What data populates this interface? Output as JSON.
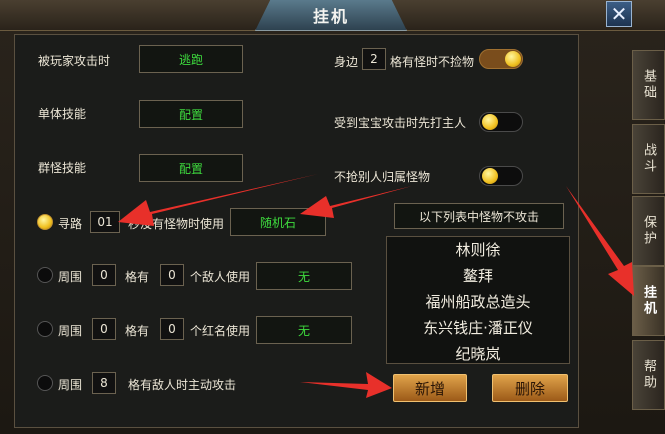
{
  "window": {
    "title": "挂机",
    "close_symbol": "✕"
  },
  "left": {
    "attacked_by_player": {
      "label": "被玩家攻击时",
      "value": "逃跑"
    },
    "single_skill": {
      "label": "单体技能",
      "value": "配置"
    },
    "group_skill": {
      "label": "群怪技能",
      "value": "配置"
    },
    "find_path": {
      "label": "寻路",
      "seconds": "01",
      "text": "秒没有怪物时使用",
      "item": "随机石"
    },
    "around_enemy": {
      "label": "周围",
      "count": "0",
      "mid": "格有",
      "num": "0",
      "text": "个敌人使用",
      "item": "无"
    },
    "around_red": {
      "label": "周围",
      "count": "0",
      "mid": "格有",
      "num": "0",
      "text": "个红名使用",
      "item": "无"
    },
    "around_attack": {
      "label": "周围",
      "count": "8",
      "text": "格有敌人时主动攻击"
    }
  },
  "right": {
    "pickup": {
      "prefix": "身边",
      "num": "2",
      "suffix": "格有怪时不捡物"
    },
    "pet_attack": {
      "label": "受到宝宝攻击时先打主人"
    },
    "no_steal": {
      "label": "不抢别人归属怪物"
    },
    "list_header": "以下列表中怪物不攻击",
    "monsters": [
      "林则徐",
      "鳌拜",
      "福州船政总造头",
      "东兴钱庄·潘正仪",
      "纪晓岚"
    ],
    "add_button": "新增",
    "delete_button": "删除"
  },
  "tabs": [
    {
      "label": "基础"
    },
    {
      "label": "战斗"
    },
    {
      "label": "保护"
    },
    {
      "label": "挂机"
    },
    {
      "label": "帮助"
    }
  ],
  "colors": {
    "accent_green": "#3edc3e",
    "arrow_red": "#e8302a",
    "button_orange": "#d08a30"
  }
}
